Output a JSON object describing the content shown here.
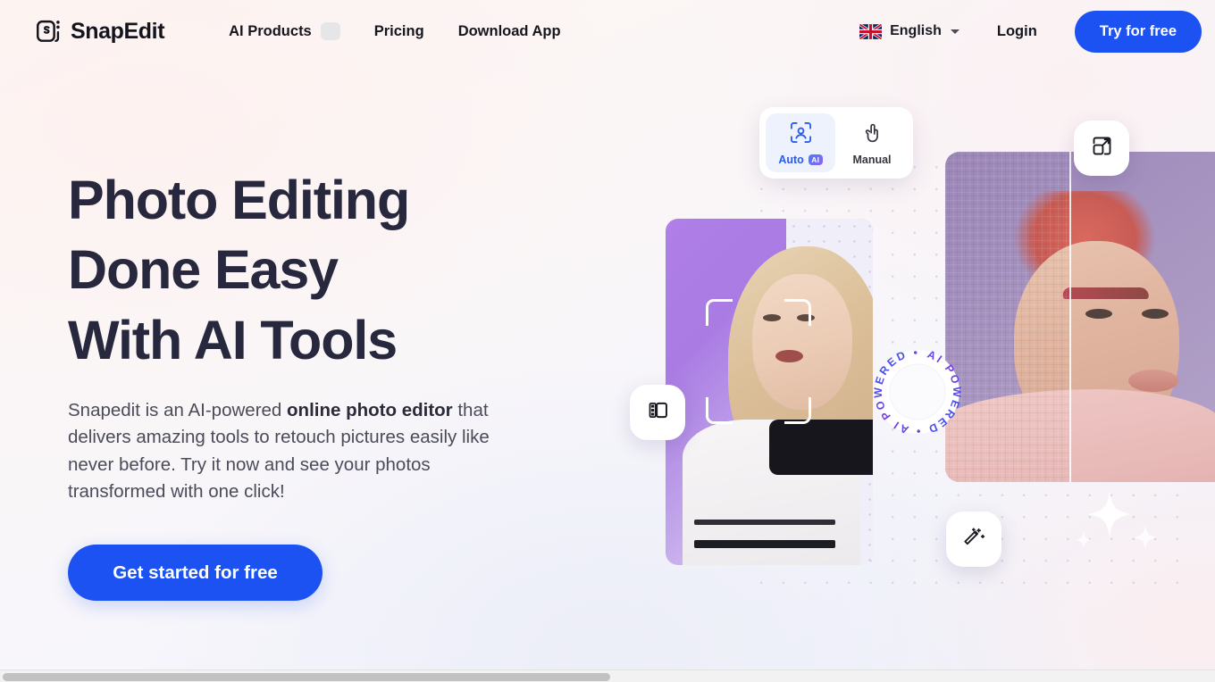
{
  "brand": {
    "name": "SnapEdit",
    "logo_icon": "snapedit-logo-icon"
  },
  "nav": {
    "links": [
      {
        "label": "AI Products",
        "has_chip": true
      },
      {
        "label": "Pricing",
        "has_chip": false
      },
      {
        "label": "Download App",
        "has_chip": false
      }
    ],
    "language": {
      "label": "English",
      "flag_icon": "uk-flag-icon",
      "caret_icon": "chevron-down-icon"
    },
    "login_label": "Login",
    "try_label": "Try for free"
  },
  "hero": {
    "headline": "Photo Editing\nDone Easy\nWith AI Tools",
    "subcopy_before": "Snapedit is an AI-powered ",
    "subcopy_bold": "online photo editor",
    "subcopy_after": " that delivers amazing tools to retouch pictures easily like never before. Try it now and see your photos transformed with one click!",
    "cta_label": "Get started for free"
  },
  "visual": {
    "tool_card": {
      "tabs": [
        {
          "label": "Auto",
          "badge": "AI",
          "icon": "face-scan-icon",
          "active": true
        },
        {
          "label": "Manual",
          "badge": "",
          "icon": "hand-pointer-icon",
          "active": false
        }
      ]
    },
    "ai_ring_text": "AI POWERED • AI POWERED • ",
    "fabs": [
      {
        "name": "upscale-icon"
      },
      {
        "name": "background-remove-icon"
      },
      {
        "name": "magic-wand-icon"
      }
    ],
    "face_detection": "face-detect-brackets"
  },
  "colors": {
    "accent_blue": "#1c52f2",
    "headline_navy": "#27273d",
    "body_gray": "#4b4b5a",
    "tab_active_blue": "#2a5bf0",
    "tab_active_bg": "#eef2fd"
  }
}
